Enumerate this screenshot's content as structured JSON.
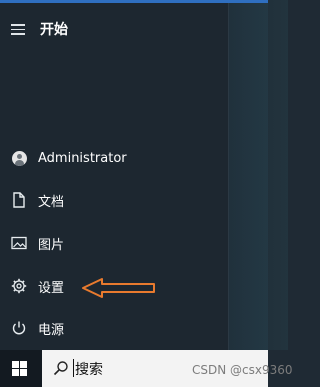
{
  "start_menu": {
    "title": "开始",
    "items": [
      {
        "label": "Administrator",
        "icon": "user-avatar-icon"
      },
      {
        "label": "文档",
        "icon": "document-icon"
      },
      {
        "label": "图片",
        "icon": "picture-icon"
      },
      {
        "label": "设置",
        "icon": "gear-icon"
      },
      {
        "label": "电源",
        "icon": "power-icon"
      }
    ]
  },
  "taskbar": {
    "search_text": "搜索",
    "watermark": "CSDN @csx9360"
  },
  "annotation": {
    "arrow_color": "#e87a2e"
  },
  "colors": {
    "start_pane": "#1d2730",
    "accent": "#2f6fc0"
  }
}
